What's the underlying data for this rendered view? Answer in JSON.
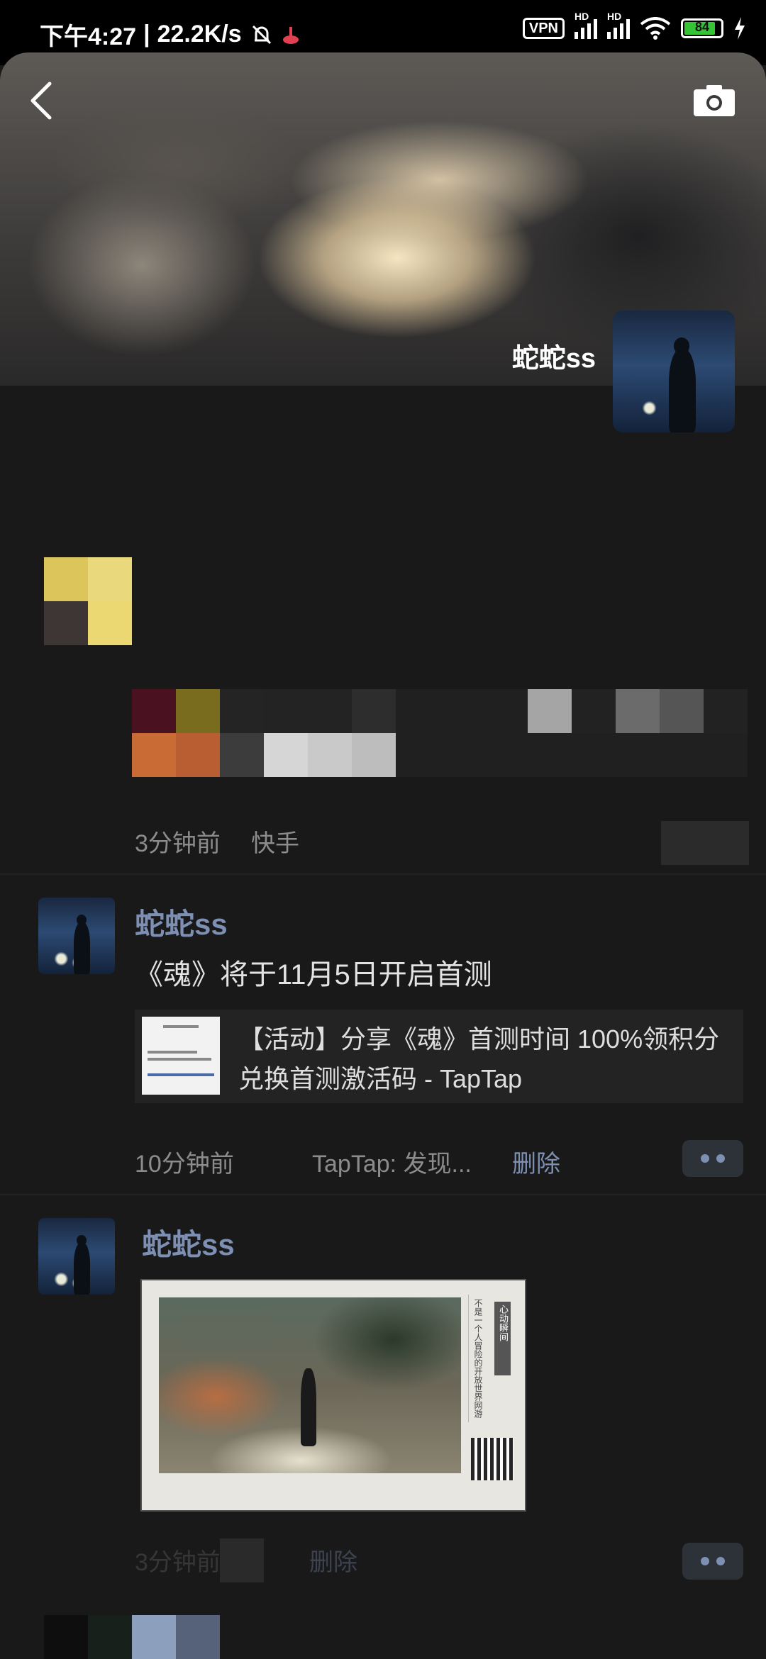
{
  "status_bar": {
    "time": "下午4:27",
    "separator": "|",
    "speed": "22.2K/s",
    "vpn": "VPN",
    "hd1": "HD",
    "hd2": "HD",
    "battery": "84"
  },
  "header": {
    "user_name": "蛇蛇ss"
  },
  "moments": [
    {
      "time": "3分钟前",
      "source": "快手"
    },
    {
      "author": "蛇蛇ss",
      "text": "《魂》将于11月5日开启首测",
      "link_title": "【活动】分享《魂》首测时间 100%领积分兑换首测激活码 - TapTap",
      "time": "10分钟前",
      "source": "TapTap: 发现...",
      "delete_label": "删除"
    },
    {
      "author": "蛇蛇ss",
      "image_text": "不是一个人冒险的开放世界网游",
      "image_side_label": "心动瞬间",
      "time": "3分钟前",
      "delete_label": "删除"
    }
  ],
  "icons": {
    "back": "back-arrow-icon",
    "camera": "camera-icon",
    "more": "more-dots-icon"
  },
  "colors": {
    "background": "#191919",
    "link_blue": "#7d90b3",
    "status_bar": "#000000"
  }
}
